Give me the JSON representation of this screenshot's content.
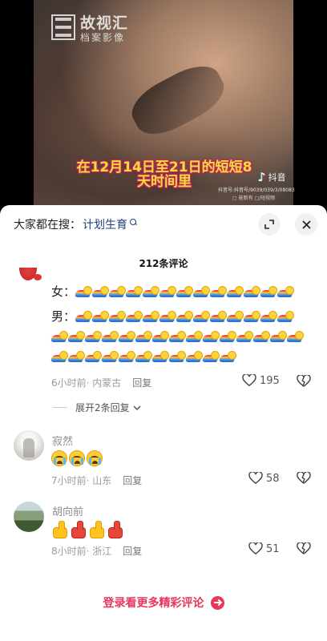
{
  "video": {
    "watermark_main": "故视汇",
    "watermark_sub": "档案影像",
    "subtitle_line1": "在12月14日至21日的短短8",
    "subtitle_line2": "天时间里",
    "platform_name": "抖音",
    "account_id": "抖音号:抖音号/9039/039/3/08083",
    "extra_text": "□ 能新有 □/短视频"
  },
  "sheet": {
    "search_prefix": "大家都在搜：",
    "search_term": "计划生育",
    "comment_count": "212条评论"
  },
  "comments": [
    {
      "lines": [
        {
          "label": "女：",
          "emoji": "rainbow-wave",
          "count": 13
        },
        {
          "label": "男：",
          "emoji": "rainbow-wave",
          "count": 39
        }
      ],
      "time": "6小时前",
      "location": "· 内蒙古",
      "reply": "回复",
      "likes": "195",
      "expand": "展开2条回复"
    },
    {
      "nick": "寂然",
      "emoji": "loudly-crying-face",
      "count": 3,
      "time": "7小时前",
      "location": "· 山东",
      "reply": "回复",
      "likes": "58"
    },
    {
      "nick": "胡向前",
      "emoji": "thumbs-up",
      "count": 4,
      "time": "8小时前",
      "location": "· 浙江",
      "reply": "回复",
      "likes": "51"
    }
  ],
  "login_cta": "登录看更多精彩评论",
  "colors": {
    "accent": "#e8365d",
    "search_term": "#1a3f7a",
    "subtitle_fill": "#f1dd3a",
    "subtitle_stroke": "#c8245a"
  }
}
